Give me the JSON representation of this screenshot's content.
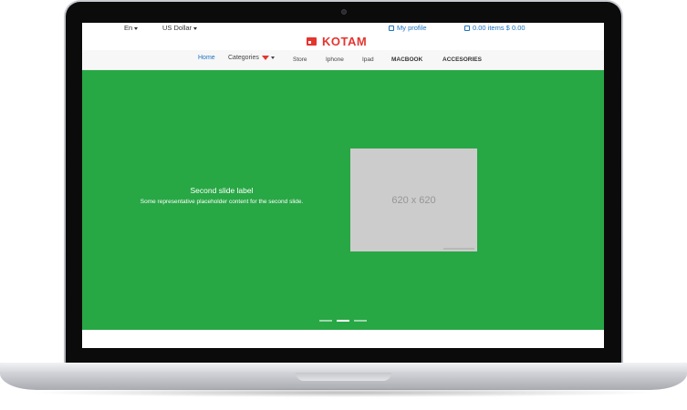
{
  "topbar": {
    "language": "En",
    "currency": "US Dollar",
    "profile": "My profile",
    "cart": "0.00 items $ 0.00"
  },
  "logo": {
    "text": "KOTAM"
  },
  "nav": {
    "items": [
      {
        "label": "Home"
      },
      {
        "label": "Categories"
      },
      {
        "label": "Store"
      },
      {
        "label": "Iphone"
      },
      {
        "label": "Ipad"
      },
      {
        "label": "MACBOOK"
      },
      {
        "label": "ACCESORIES"
      }
    ]
  },
  "carousel": {
    "caption_title": "Second slide label",
    "caption_text": "Some representative placeholder content for the second slide.",
    "image_text": "620 x 620",
    "active_slide": 2,
    "slide_count": 3
  },
  "colors": {
    "brand": "#e4352f",
    "carousel_bg": "#28a745",
    "link": "#1e73be"
  }
}
